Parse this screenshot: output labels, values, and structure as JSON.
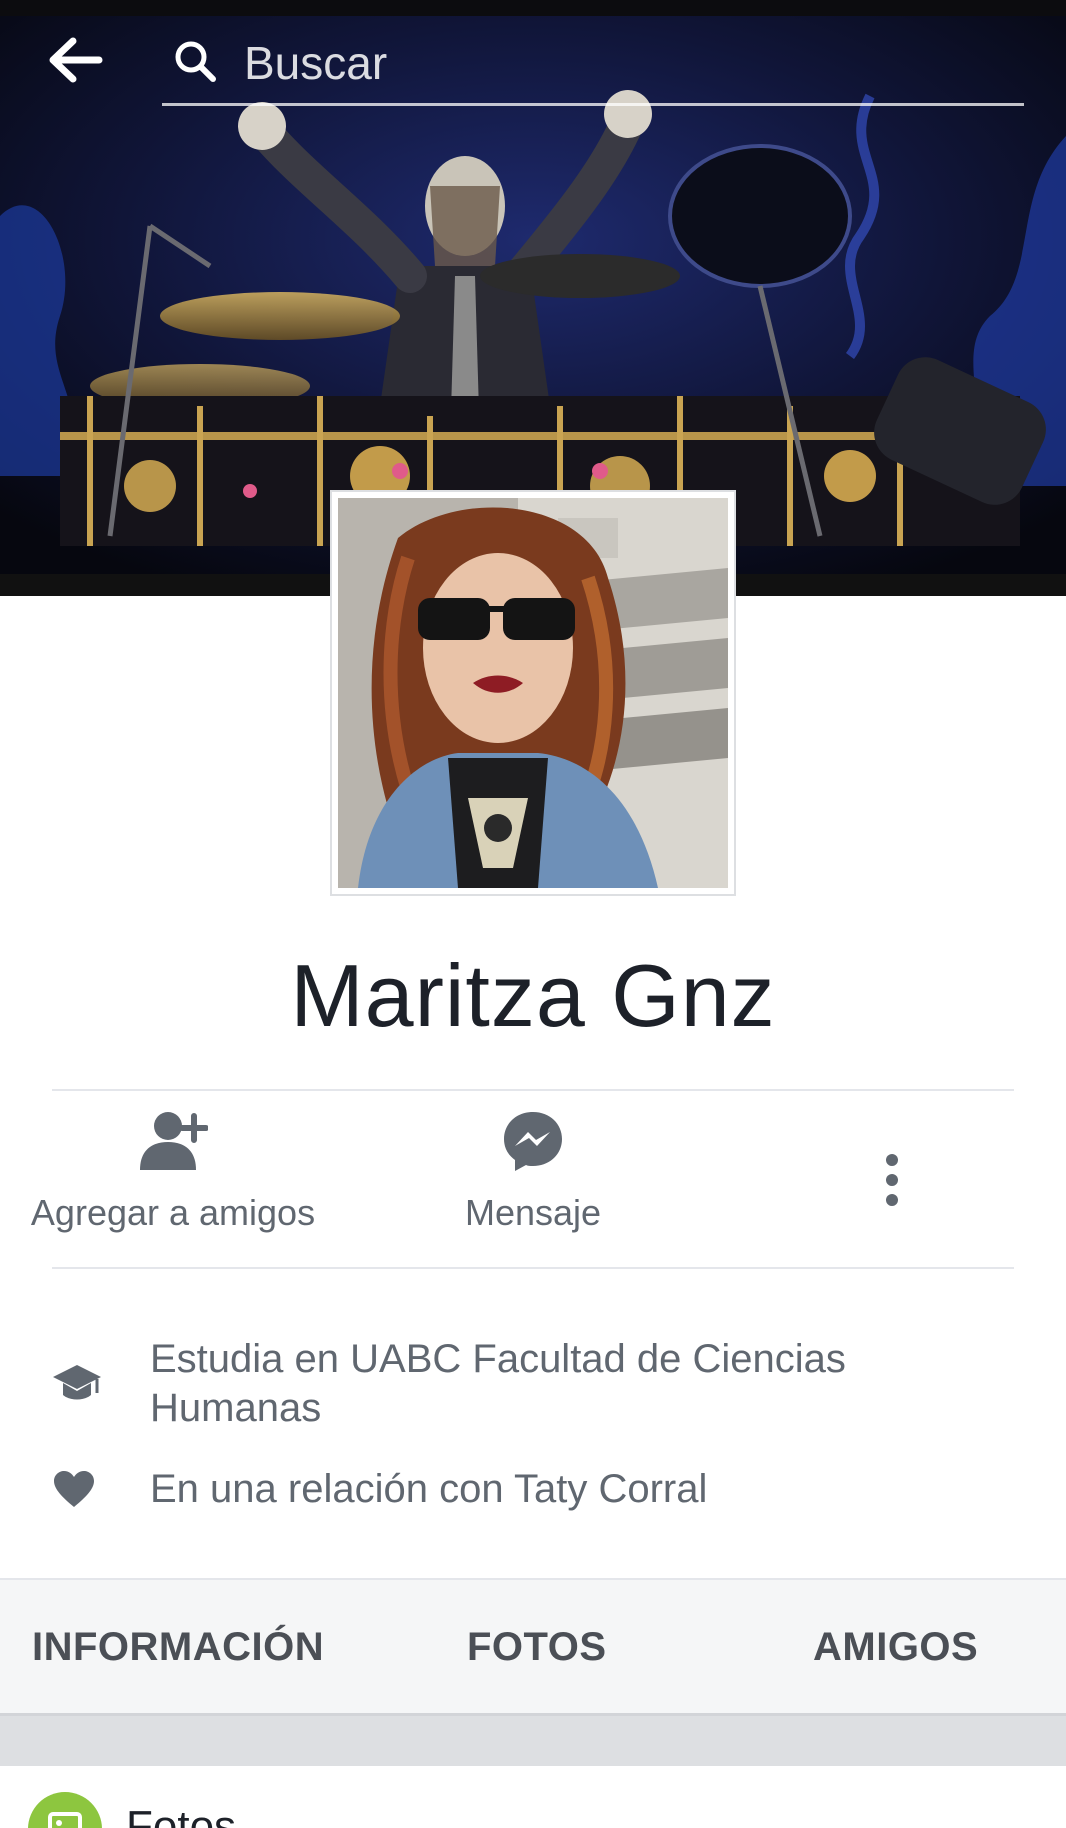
{
  "header": {
    "back_icon": "arrow-left-icon",
    "search_icon": "search-icon",
    "search_placeholder": "Buscar",
    "search_value": ""
  },
  "profile": {
    "name": "Maritza Gnz",
    "cover_description": "",
    "picture_icon": "profile-photo"
  },
  "actions": [
    {
      "label": "Agregar a amigos",
      "icon": "add-friend-icon"
    },
    {
      "label": "Mensaje",
      "icon": "messenger-icon"
    },
    {
      "label": "",
      "icon": "more-vertical-icon"
    }
  ],
  "about": [
    {
      "icon": "graduation-cap-icon",
      "text": "Estudia en UABC Facultad de Ciencias Humanas"
    },
    {
      "icon": "heart-icon",
      "text": "En una relación con Taty Corral"
    }
  ],
  "tabs": [
    {
      "label": "INFORMACIÓN"
    },
    {
      "label": "FOTOS"
    },
    {
      "label": "AMIGOS"
    }
  ],
  "sections": {
    "photos_title": "Fotos",
    "photos_icon": "photos-icon"
  },
  "colors": {
    "text_primary": "#1d2129",
    "text_secondary": "#606770",
    "icon_gray": "#606770",
    "tab_bg": "#f5f6f7",
    "photos_accent": "#8dc63f"
  }
}
